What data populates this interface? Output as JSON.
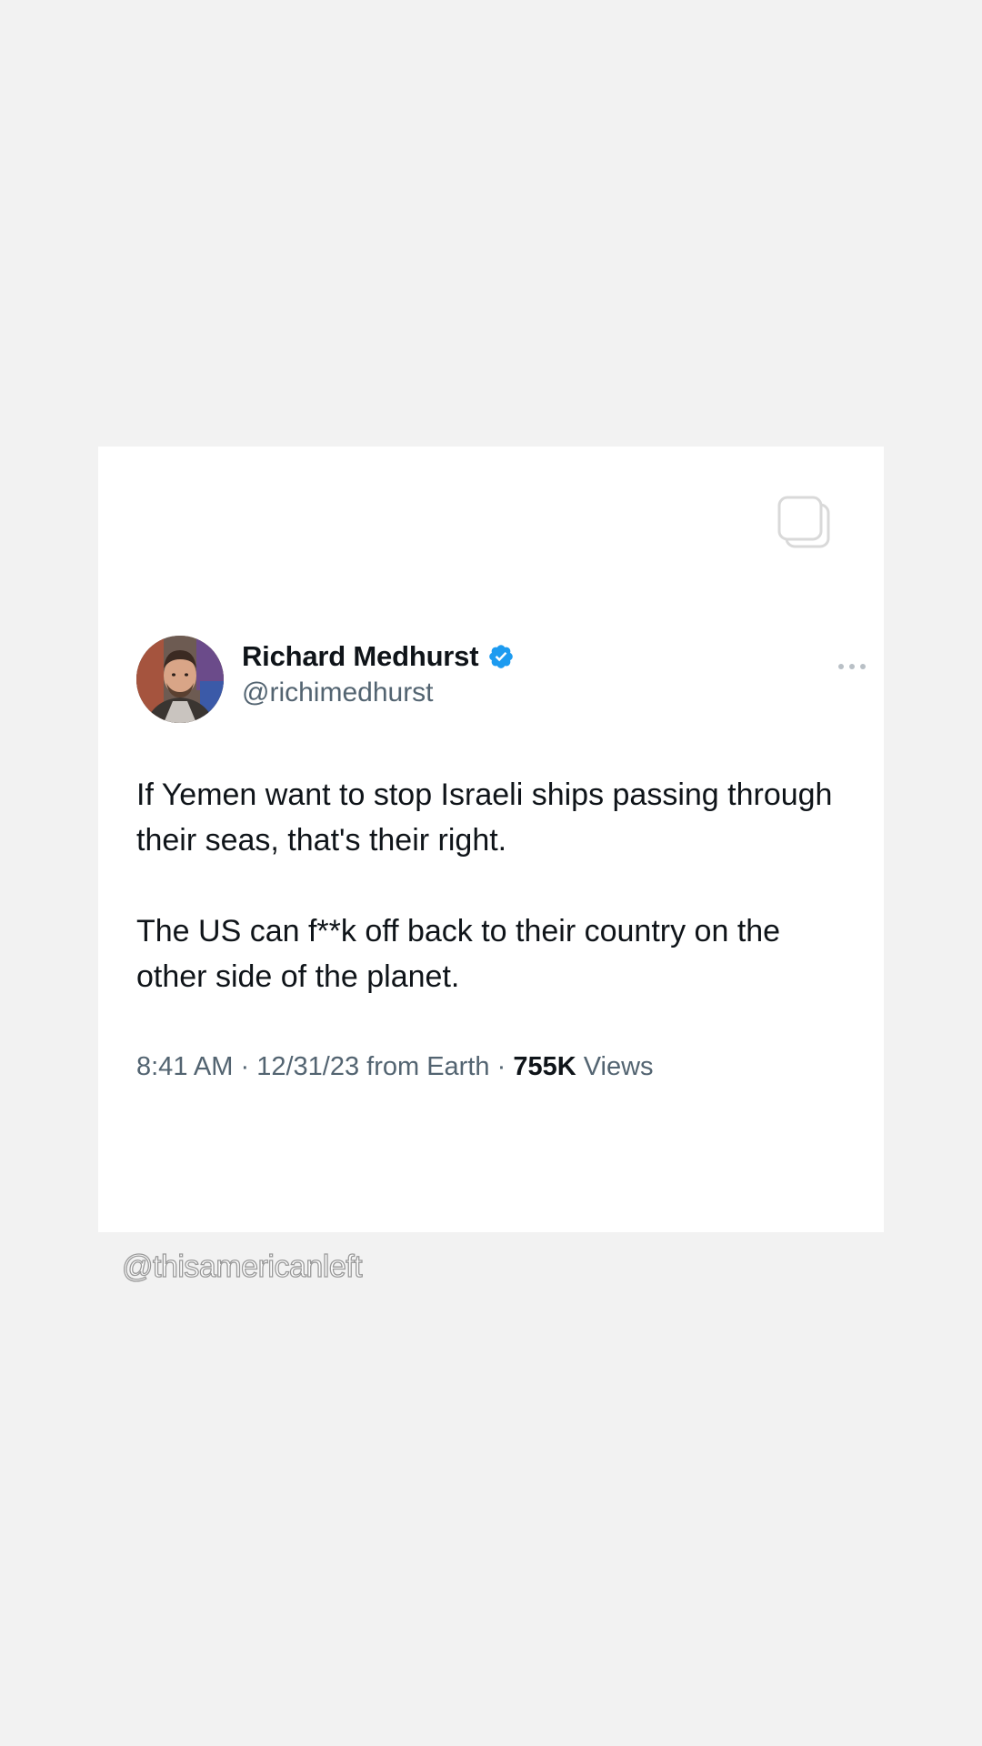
{
  "tweet": {
    "author": {
      "display_name": "Richard Medhurst",
      "handle": "@richimedhurst",
      "verified": true,
      "avatar_icon": "profile-photo"
    },
    "text_paragraphs": [
      "If Yemen want to stop Israeli ships passing through their seas, that's their right.",
      "The US can f**k off back to their country on the other side of the planet."
    ],
    "meta": {
      "time": "8:41 AM",
      "separator": "·",
      "date": "12/31/23",
      "source": "from Earth",
      "views_count": "755K",
      "views_label": "Views"
    },
    "icons": {
      "copy": "copy-icon",
      "more": "more-options-icon",
      "verified": "verified-badge-icon"
    }
  },
  "watermark": "@thisamericanleft",
  "colors": {
    "page_background": "#f2f2f2",
    "card_background": "#ffffff",
    "text_primary": "#0f1419",
    "text_secondary": "#536471",
    "verified_blue": "#1d9bf0"
  }
}
